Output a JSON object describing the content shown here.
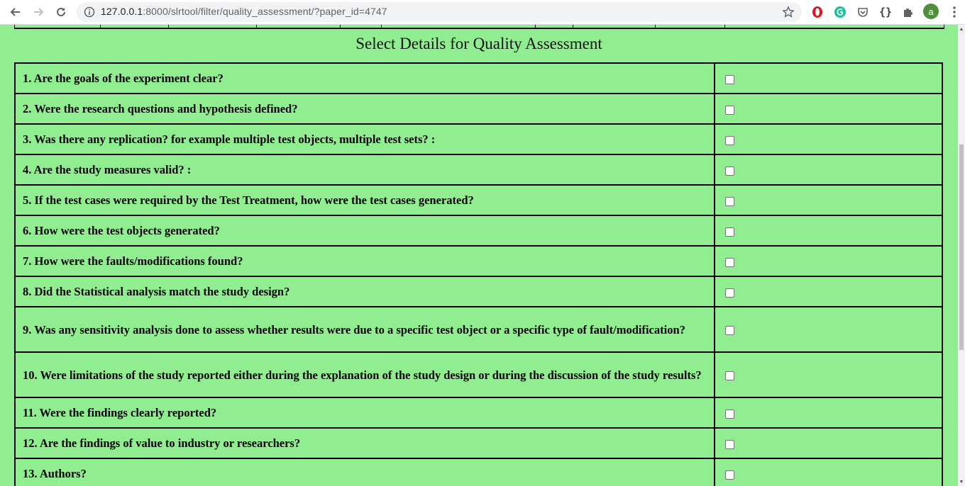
{
  "browser": {
    "url_host": "127.0.0.1",
    "url_path": ":8000/slrtool/filter/quality_assessment/?paper_id=4747",
    "avatar_letter": "a",
    "extensions": [
      "opera-icon",
      "grammarly-icon",
      "pocket-icon",
      "json-icon",
      "puzzle-icon"
    ]
  },
  "page": {
    "title": "Select Details for Quality Assessment"
  },
  "questions": [
    {
      "label": "1. Are the goals of the experiment clear?",
      "checked": false
    },
    {
      "label": "2. Were the research questions and hypothesis defined?",
      "checked": false
    },
    {
      "label": "3. Was there any replication? for example multiple test objects, multiple test sets? :",
      "checked": false
    },
    {
      "label": "4. Are the study measures valid? :",
      "checked": false
    },
    {
      "label": "5. If the test cases were required by the Test Treatment, how were the test cases generated?",
      "checked": false
    },
    {
      "label": "6. How were the test objects generated?",
      "checked": false
    },
    {
      "label": "7. How were the faults/modifications found?",
      "checked": false
    },
    {
      "label": "8. Did the Statistical analysis match the study design?",
      "checked": false
    },
    {
      "label": "9. Was any sensitivity analysis done to assess whether results were due to a specific test object or a specific type of fault/modification?",
      "checked": false
    },
    {
      "label": "10. Were limitations of the study reported either during the explanation of the study design or during the discussion of the study results?",
      "checked": false
    },
    {
      "label": "11. Were the findings clearly reported?",
      "checked": false
    },
    {
      "label": "12. Are the findings of value to industry or researchers?",
      "checked": false
    },
    {
      "label": "13. Authors?",
      "checked": false
    }
  ]
}
